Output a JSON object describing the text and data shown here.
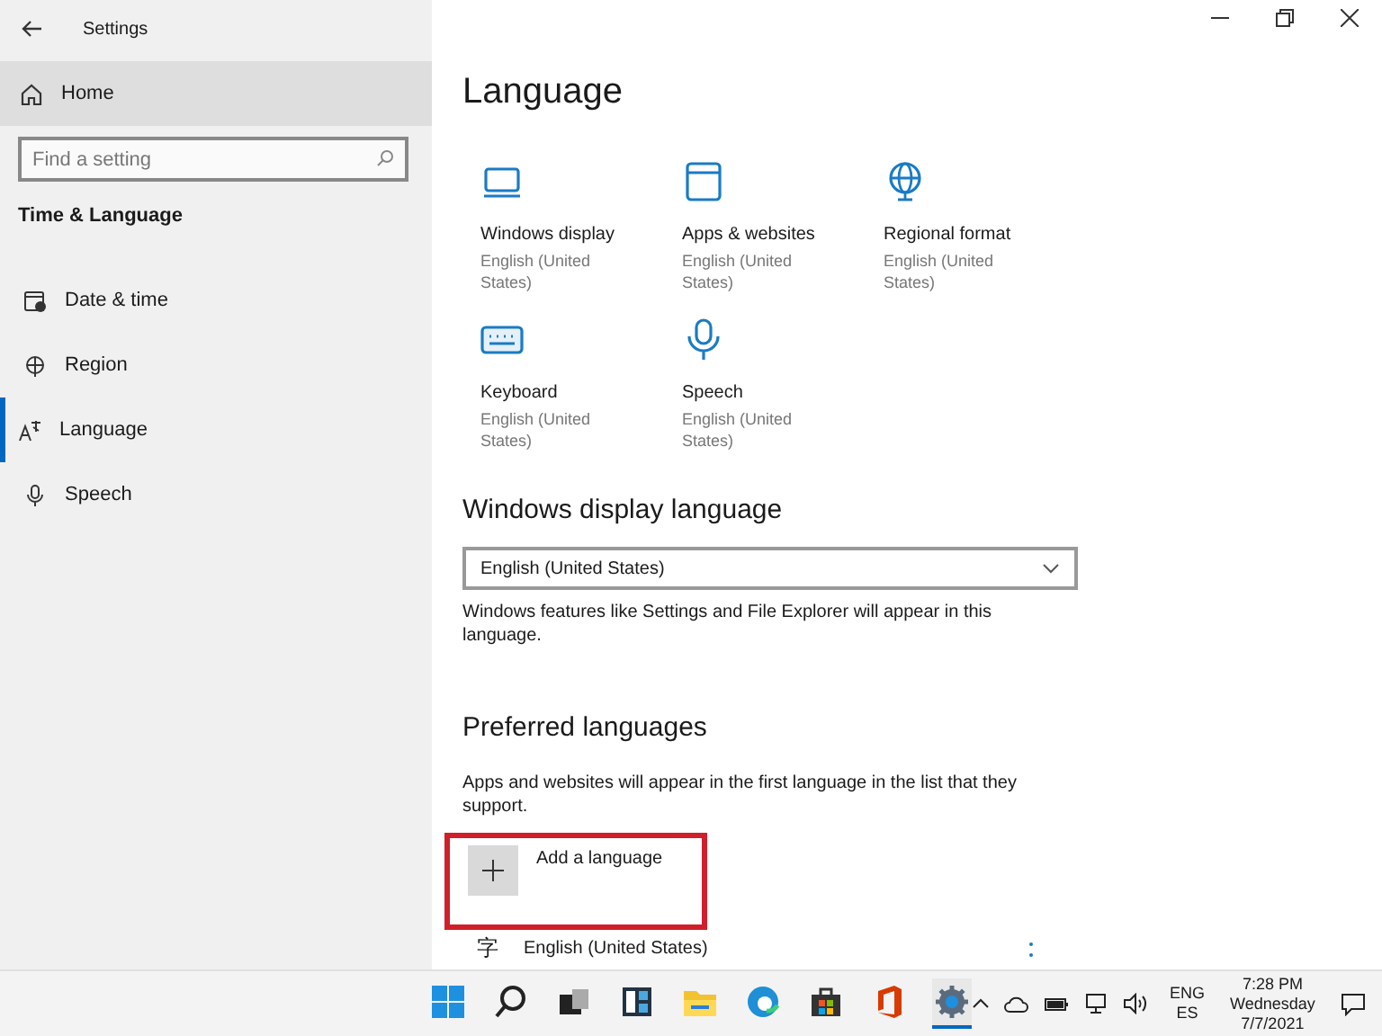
{
  "window": {
    "title": "Settings"
  },
  "sidebar": {
    "home": {
      "label": "Home",
      "selected": true
    },
    "search": {
      "placeholder": "Find a setting"
    },
    "section": "Time & Language",
    "items": [
      {
        "label": "Date & time",
        "selected": false
      },
      {
        "label": "Region",
        "selected": false
      },
      {
        "label": "Language",
        "selected": true
      },
      {
        "label": "Speech",
        "selected": false
      }
    ]
  },
  "main": {
    "title": "Language",
    "tiles": [
      {
        "title": "Windows display",
        "subtitle": "English (United States)"
      },
      {
        "title": "Apps & websites",
        "subtitle": "English (United States)"
      },
      {
        "title": "Regional format",
        "subtitle": "English (United States)"
      },
      {
        "title": "Keyboard",
        "subtitle": "English (United States)"
      },
      {
        "title": "Speech",
        "subtitle": "English (United States)"
      }
    ],
    "display_language": {
      "heading": "Windows display language",
      "value": "English (United States)",
      "note": "Windows features like Settings and File Explorer will appear in this language."
    },
    "preferred": {
      "heading": "Preferred languages",
      "note": "Apps and websites will appear in the first language in the list that they support.",
      "add_button": {
        "label": "Add a language",
        "highlighted": true
      },
      "languages": [
        {
          "icon": "字",
          "name": "English (United States)"
        }
      ]
    }
  },
  "taskbar": {
    "apps": [
      {
        "selected": false
      },
      {
        "selected": false
      },
      {
        "selected": false
      },
      {
        "selected": false
      },
      {
        "selected": false
      },
      {
        "selected": false
      },
      {
        "selected": false
      },
      {
        "selected": false
      },
      {
        "selected": true
      }
    ],
    "input_language": "ENG",
    "input_layout": "ES",
    "time": "7:28 PM",
    "day": "Wednesday",
    "date": "7/7/2021"
  }
}
